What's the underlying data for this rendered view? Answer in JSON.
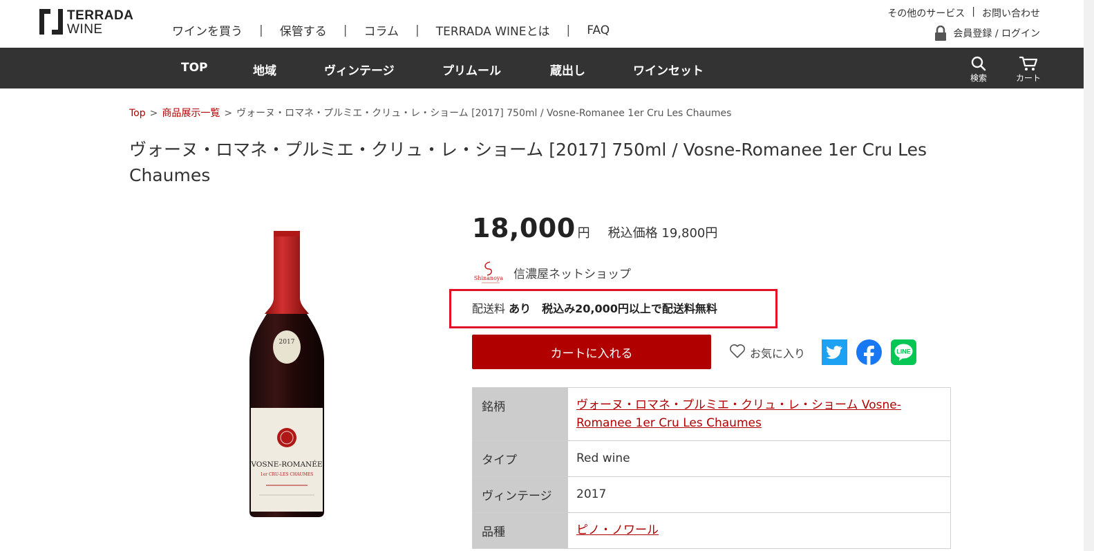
{
  "brand": {
    "line1": "TERRADA",
    "line2": "WINE"
  },
  "topnav": [
    "ワインを買う",
    "保管する",
    "コラム",
    "TERRADA WINEとは",
    "FAQ"
  ],
  "util": {
    "other_services": "その他のサービス",
    "contact": "お問い合わせ",
    "login": "会員登録 / ログイン"
  },
  "mainnav": [
    "TOP",
    "地域",
    "ヴィンテージ",
    "プリムール",
    "蔵出し",
    "ワインセット"
  ],
  "icons": {
    "search": "検索",
    "cart": "カート"
  },
  "breadcrumb": {
    "top": "Top",
    "list": "商品展示一覧",
    "current": "ヴォーヌ・ロマネ・プルミエ・クリュ・レ・ショーム [2017] 750ml / Vosne-Romanee 1er Cru Les Chaumes"
  },
  "product": {
    "title": "ヴォーヌ・ロマネ・プルミエ・クリュ・レ・ショーム [2017] 750ml / Vosne-Romanee 1er Cru Les Chaumes",
    "price": "18,000",
    "yen": "円",
    "tax_price": "税込価格 19,800円",
    "shop_name": "信濃屋ネットショップ",
    "shop_logo_text": "Shinanoya",
    "shipping_label": "配送料",
    "shipping_value": "あり　税込み20,000円以上で配送料無料",
    "cart_button": "カートに入れる",
    "favorite": "お気に入り",
    "bottle_label": "VOSNE-ROMANÉE",
    "bottle_sub": "1er CRU-LES CHAUMES",
    "bottle_year": "2017",
    "social": {
      "line": "LINE"
    }
  },
  "spec": [
    {
      "key": "銘柄",
      "value": "ヴォーヌ・ロマネ・プルミエ・クリュ・レ・ショーム Vosne-Romanee 1er Cru Les Chaumes",
      "link": true
    },
    {
      "key": "タイプ",
      "value": "Red wine",
      "link": false
    },
    {
      "key": "ヴィンテージ",
      "value": "2017",
      "link": false
    },
    {
      "key": "品種",
      "value": "ピノ・ノワール",
      "link": true
    }
  ],
  "colors": {
    "accent": "#b00000",
    "nav_bg": "#333333",
    "highlight": "#e0102a"
  }
}
